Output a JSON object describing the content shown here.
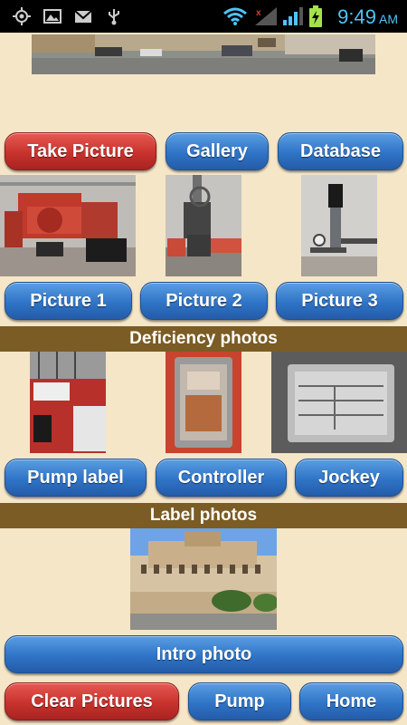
{
  "status_bar": {
    "time": "9:49",
    "ampm": "AM",
    "icons": [
      "gps-icon",
      "image-icon",
      "mail-icon",
      "usb-icon",
      "wifi-icon",
      "no-signal-icon",
      "signal-icon",
      "battery-icon"
    ]
  },
  "buttons_top": {
    "take_picture": "Take Picture",
    "gallery": "Gallery",
    "database": "Database"
  },
  "picture_buttons": [
    "Picture 1",
    "Picture 2",
    "Picture 3"
  ],
  "deficiency_header": "Deficiency photos",
  "label_buttons": [
    "Pump label",
    "Controller",
    "Jockey"
  ],
  "label_header": "Label photos",
  "intro_button": "Intro photo",
  "bottom_buttons": {
    "clear": "Clear Pictures",
    "pump": "Pump",
    "home": "Home"
  },
  "colors": {
    "background": "#f5e6c8",
    "section_bar": "#7a5c24",
    "button_blue": "#2f74c7",
    "button_red": "#c8322d",
    "clock": "#4fc3f7"
  }
}
